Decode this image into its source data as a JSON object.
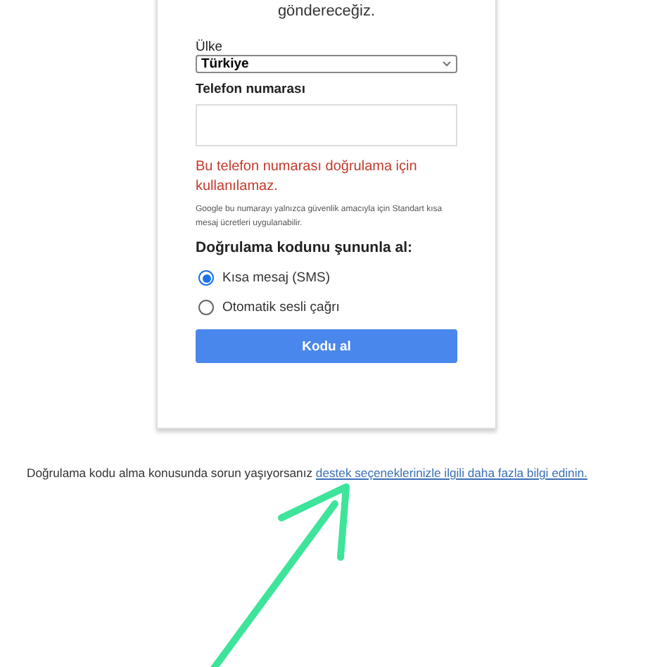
{
  "card": {
    "intro": "göndereceğiz.",
    "country_label": "Ülke",
    "country_value": "Türkiye",
    "phone_label": "Telefon numarası",
    "error": "Bu telefon numarası doğrulama için kullanılamaz.",
    "note": "Google bu numarayı yalnızca güvenlik amacıyla için Standart kısa mesaj ücretleri uygulanabilir.",
    "method_title": "Doğrulama kodunu şununla al:",
    "methods": [
      {
        "label": "Kısa mesaj (SMS)",
        "selected": true
      },
      {
        "label": "Otomatik sesli çağrı",
        "selected": false
      }
    ],
    "submit": "Kodu al"
  },
  "footer": {
    "text": "Doğrulama kodu alma konusunda sorun yaşıyorsanız",
    "link": "destek seçeneklerinizle ilgili daha fazla bilgi edinin."
  }
}
